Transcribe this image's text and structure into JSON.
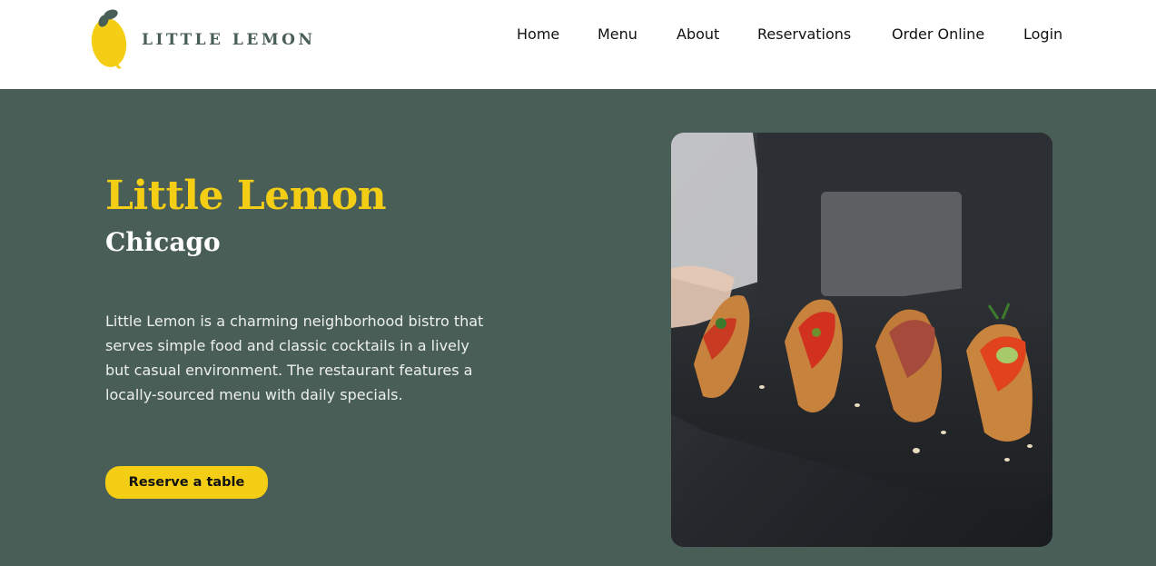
{
  "brand": {
    "name": "LITTLE LEMON",
    "accent_color": "#f4ce14",
    "primary_color": "#495e57",
    "logo_icon": "lemon-icon"
  },
  "nav": {
    "items": [
      {
        "label": "Home"
      },
      {
        "label": "Menu"
      },
      {
        "label": "About"
      },
      {
        "label": "Reservations"
      },
      {
        "label": "Order Online"
      },
      {
        "label": "Login"
      }
    ]
  },
  "hero": {
    "title": "Little Lemon",
    "subtitle": "Chicago",
    "description": "Little Lemon is a charming neighborhood bistro that serves simple food and classic cocktails in a lively but casual environment. The restaurant features a locally-sourced menu with daily specials.",
    "cta_label": "Reserve a table",
    "image_subject": "hero-food-photo"
  }
}
